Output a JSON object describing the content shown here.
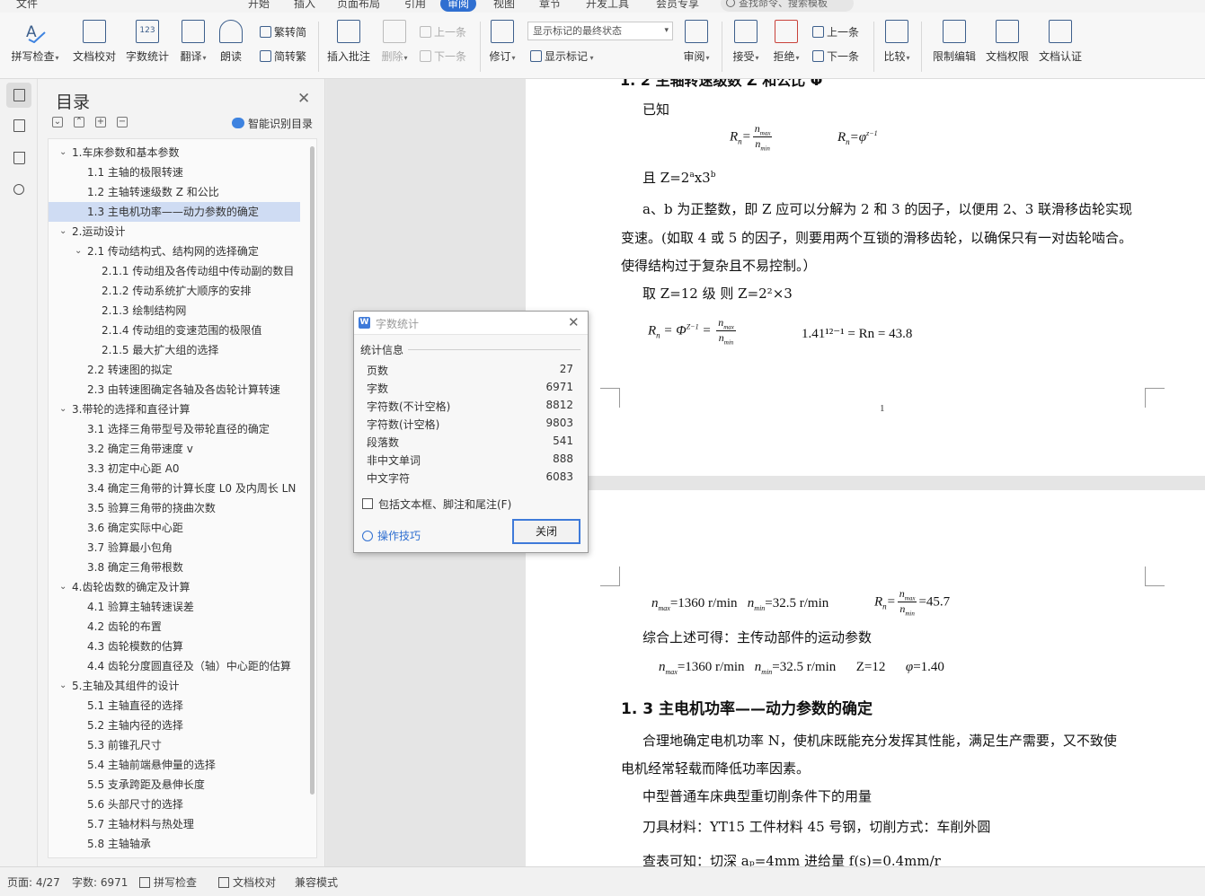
{
  "menubar": {
    "items": [
      "文件",
      "开始",
      "插入",
      "页面布局",
      "引用",
      "审阅",
      "视图",
      "章节",
      "开发工具",
      "会员专享"
    ],
    "active": "审阅",
    "search_placeholder": "查找命令、搜索模板"
  },
  "ribbon": {
    "spell_check": "拼写检查",
    "doc_proof": "文档校对",
    "word_count": "字数统计",
    "translate": "翻译",
    "read_aloud": "朗读",
    "to_traditional": "繁转简",
    "to_simplified": "简转繁",
    "insert_comment": "插入批注",
    "delete": "删除",
    "prev_comment": "上一条",
    "next_comment": "下一条",
    "track_changes": "修订",
    "markup_mode": "显示标记的最终状态",
    "show_markup": "显示标记",
    "review": "审阅",
    "accept": "接受",
    "reject": "拒绝",
    "prev_change": "上一条",
    "next_change": "下一条",
    "compare": "比较",
    "restrict_edit": "限制编辑",
    "doc_permission": "文档权限",
    "doc_certify": "文档认证"
  },
  "toc": {
    "title": "目录",
    "smart_label": "智能识别目录",
    "items": [
      {
        "level": 1,
        "text": "1.车床参数和基本参数",
        "toggle": "open"
      },
      {
        "level": 2,
        "text": "1.1 主轴的极限转速"
      },
      {
        "level": 2,
        "text": "1.2 主轴转速级数 Z 和公比"
      },
      {
        "level": 2,
        "text": "1.3 主电机功率——动力参数的确定",
        "selected": true
      },
      {
        "level": 1,
        "text": "2.运动设计",
        "toggle": "open"
      },
      {
        "level": 2,
        "text": "2.1 传动结构式、结构网的选择确定",
        "toggle": "open"
      },
      {
        "level": 3,
        "text": "2.1.1 传动组及各传动组中传动副的数目"
      },
      {
        "level": 3,
        "text": "2.1.2 传动系统扩大顺序的安排"
      },
      {
        "level": 3,
        "text": "2.1.3 绘制结构网"
      },
      {
        "level": 3,
        "text": "2.1.4 传动组的变速范围的极限值"
      },
      {
        "level": 3,
        "text": "2.1.5 最大扩大组的选择"
      },
      {
        "level": 2,
        "text": "2.2 转速图的拟定"
      },
      {
        "level": 2,
        "text": "2.3  由转速图确定各轴及各齿轮计算转速"
      },
      {
        "level": 1,
        "text": "3.带轮的选择和直径计算",
        "toggle": "open"
      },
      {
        "level": 2,
        "text": "3.1 选择三角带型号及带轮直径的确定"
      },
      {
        "level": 2,
        "text": "3.2 确定三角带速度 v"
      },
      {
        "level": 2,
        "text": "3.3 初定中心距 A0"
      },
      {
        "level": 2,
        "text": "3.4 确定三角带的计算长度 L0 及内周长 LN"
      },
      {
        "level": 2,
        "text": "3.5 验算三角带的挠曲次数"
      },
      {
        "level": 2,
        "text": "3.6 确定实际中心距"
      },
      {
        "level": 2,
        "text": "3.7 验算最小包角"
      },
      {
        "level": 2,
        "text": "3.8 确定三角带根数"
      },
      {
        "level": 1,
        "text": "4.齿轮齿数的确定及计算",
        "toggle": "open"
      },
      {
        "level": 2,
        "text": "4.1 验算主轴转速误差"
      },
      {
        "level": 2,
        "text": "4.2 齿轮的布置"
      },
      {
        "level": 2,
        "text": "4.3  齿轮模数的估算"
      },
      {
        "level": 2,
        "text": "4.4  齿轮分度圆直径及（轴）中心距的估算"
      },
      {
        "level": 1,
        "text": "5.主轴及其组件的设计",
        "toggle": "open"
      },
      {
        "level": 2,
        "text": "5.1 主轴直径的选择"
      },
      {
        "level": 2,
        "text": "5.2 主轴内径的选择"
      },
      {
        "level": 2,
        "text": "5.3 前锥孔尺寸"
      },
      {
        "level": 2,
        "text": "5.4 主轴前端悬伸量的选择"
      },
      {
        "level": 2,
        "text": "5.5 支承跨距及悬伸长度"
      },
      {
        "level": 2,
        "text": "5.6 头部尺寸的选择"
      },
      {
        "level": 2,
        "text": "5.7 主轴材料与热处理"
      },
      {
        "level": 2,
        "text": "5.8 主轴轴承"
      }
    ]
  },
  "doc": {
    "p1_heading": "1. 2 主轴转速级数 Z 和公比 Φ",
    "p1_known": "已知",
    "p1_and": "且 Z=2",
    "p1_and_sup_a": "a",
    "p1_and_mid": "x3",
    "p1_and_sup_b": "b",
    "p1_para1_l1": "a、b 为正整数，即 Z 应可以分解为 2 和 3 的因子，以便用 2、3 联滑移齿轮实现",
    "p1_para1_l2": "变速。(如取 4 或 5 的因子，则要用两个互锁的滑移齿轮，以确保只有一对齿轮啮合。",
    "p1_para1_l3": "使得结构过于复杂且不易控制。）",
    "p1_take": "取 Z=12 级    则 Z=2²×3",
    "p1_calc": "1.41¹²⁻¹ = Rn = 43.8",
    "p1_page_number": "1",
    "p2_nmax_line": "=1360 r/min",
    "p2_nmin_line": "=32.5 r/min",
    "p2_rn_value": "=45.7",
    "p2_summary": "综合上述可得：主传动部件的运动参数",
    "p2_params_z": "Z=12",
    "p2_params_phi": "=1.40",
    "p2_heading": "1. 3 主电机功率——动力参数的确定",
    "p2_para1_l1": "合理地确定电机功率 N，使机床既能充分发挥其性能，满足生产需要，又不致使",
    "p2_para1_l2": "电机经常轻载而降低功率因素。",
    "p2_para2": "中型普通车床典型重切削条件下的用量",
    "p2_para3": "刀具材料：YT15   工件材料 45 号钢，切削方式：车削外圆",
    "p2_para4": "查表可知：切深 aₚ=4mm  进给量 f(s)=0.4mm/r"
  },
  "dialog": {
    "title": "字数统计",
    "group_label": "统计信息",
    "stats": [
      {
        "label": "页数",
        "value": "27"
      },
      {
        "label": "字数",
        "value": "6971"
      },
      {
        "label": "字符数(不计空格)",
        "value": "8812"
      },
      {
        "label": "字符数(计空格)",
        "value": "9803"
      },
      {
        "label": "段落数",
        "value": "541"
      },
      {
        "label": "非中文单词",
        "value": "888"
      },
      {
        "label": "中文字符",
        "value": "6083"
      }
    ],
    "checkbox_label": "包括文本框、脚注和尾注(F)",
    "checkbox_checked": false,
    "tips_link": "操作技巧",
    "close_button": "关闭"
  },
  "status": {
    "page": "页面: 4/27",
    "words": "字数: 6971",
    "spell": "拼写检查",
    "proof": "文档校对",
    "compat": "兼容模式"
  },
  "colors": {
    "accent": "#2f6fd1",
    "toc_selected": "#cfdcf3",
    "icon_stroke": "#3d5f8c"
  }
}
